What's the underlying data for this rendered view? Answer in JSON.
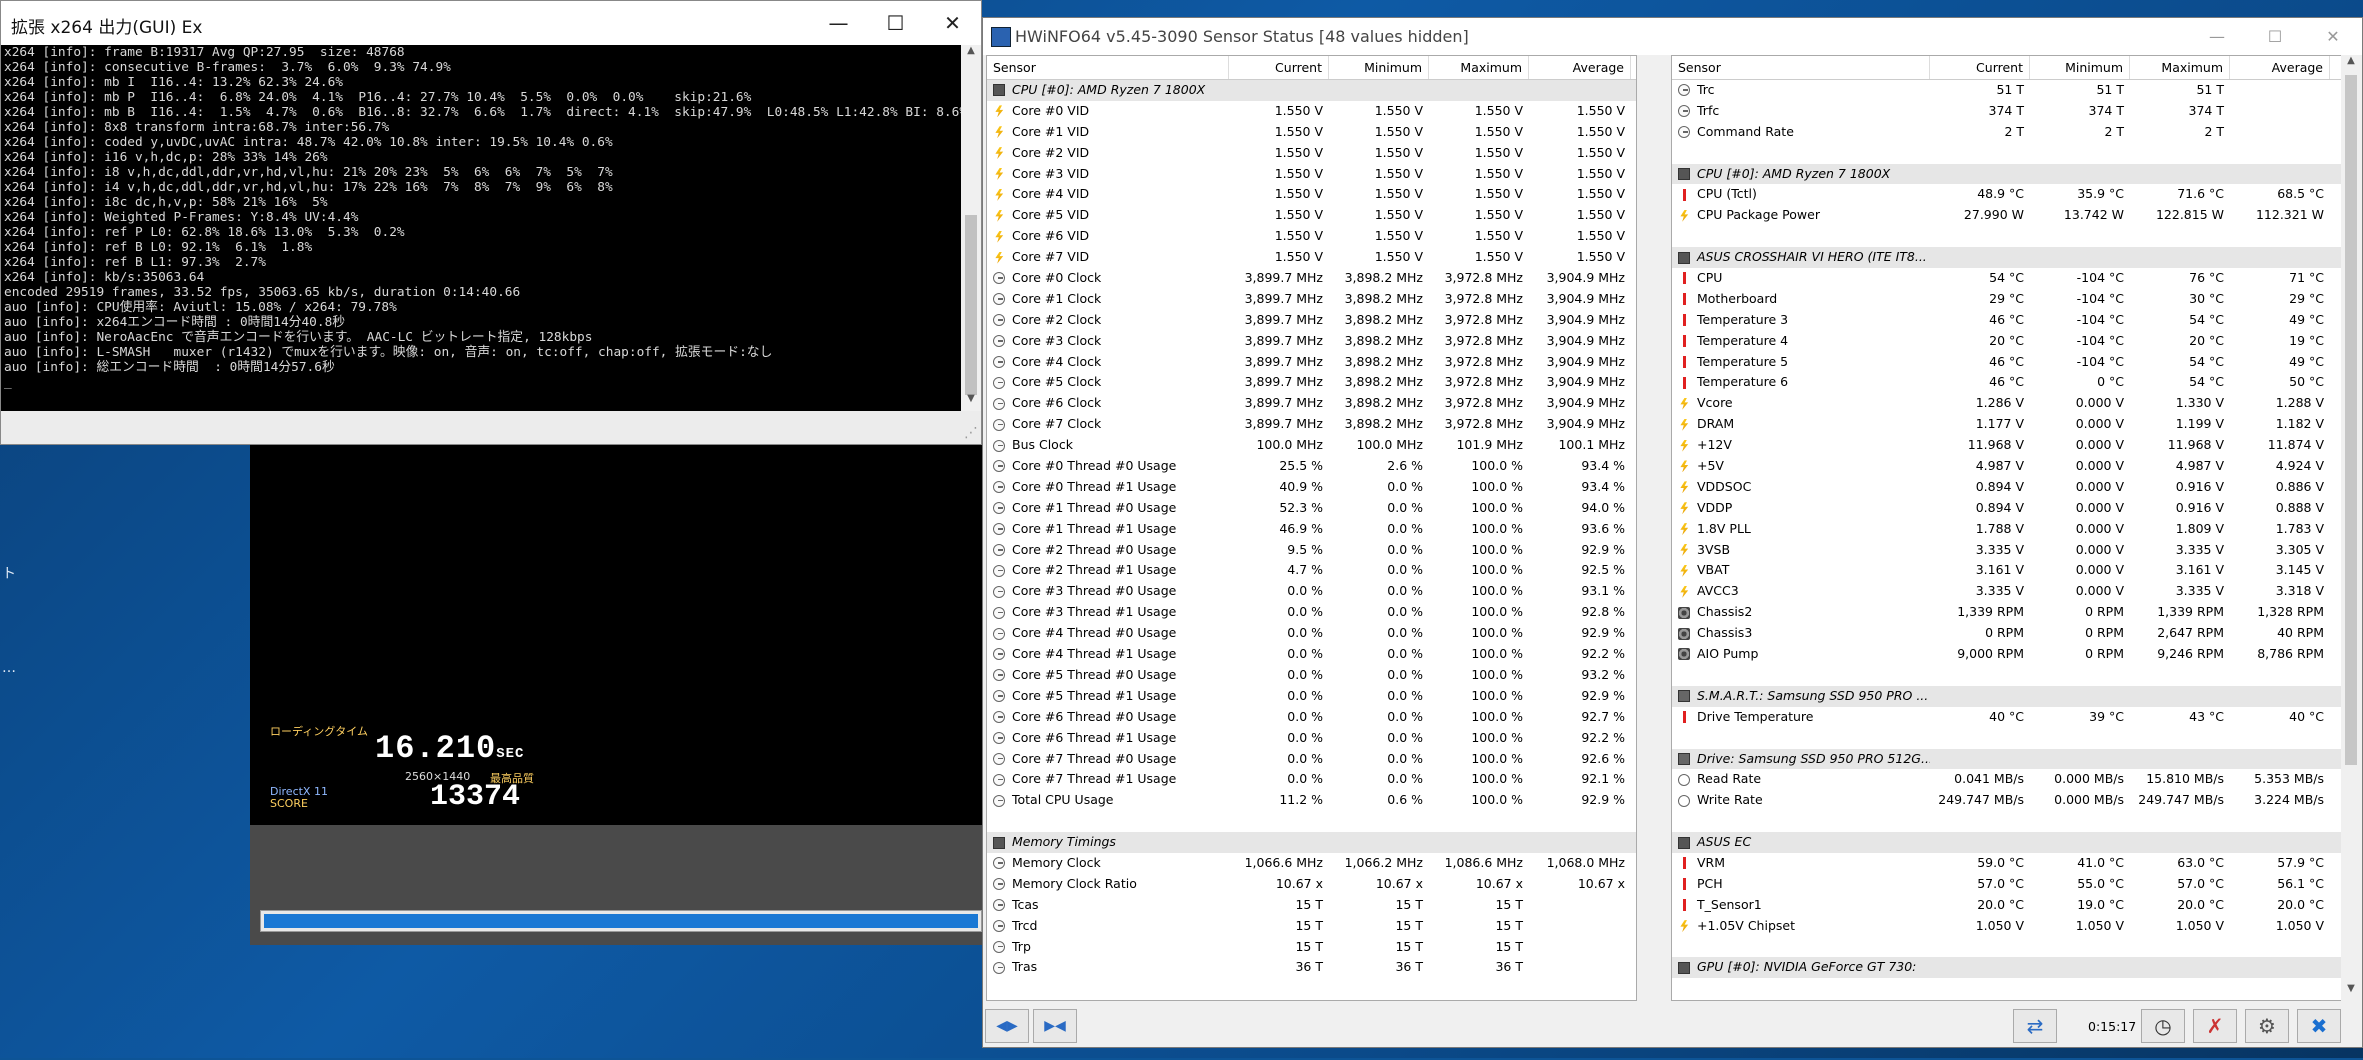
{
  "x264": {
    "title": "拡張 x264 出力(GUI) Ex",
    "lines": [
      "x264 [info]: frame B:19317 Avg QP:27.95  size: 48768",
      "x264 [info]: consecutive B-frames:  3.7%  6.0%  9.3% 74.9%",
      "x264 [info]: mb I  I16..4: 13.2% 62.3% 24.6%",
      "x264 [info]: mb P  I16..4:  6.8% 24.0%  4.1%  P16..4: 27.7% 10.4%  5.5%  0.0%  0.0%    skip:21.6%",
      "x264 [info]: mb B  I16..4:  1.5%  4.7%  0.6%  B16..8: 32.7%  6.6%  1.7%  direct: 4.1%  skip:47.9%  L0:48.5% L1:42.8% BI: 8.6%",
      "x264 [info]: 8x8 transform intra:68.7% inter:56.7%",
      "x264 [info]: coded y,uvDC,uvAC intra: 48.7% 42.0% 10.8% inter: 19.5% 10.4% 0.6%",
      "x264 [info]: i16 v,h,dc,p: 28% 33% 14% 26%",
      "x264 [info]: i8 v,h,dc,ddl,ddr,vr,hd,vl,hu: 21% 20% 23%  5%  6%  6%  7%  5%  7%",
      "x264 [info]: i4 v,h,dc,ddl,ddr,vr,hd,vl,hu: 17% 22% 16%  7%  8%  7%  9%  6%  8%",
      "x264 [info]: i8c dc,h,v,p: 58% 21% 16%  5%",
      "x264 [info]: Weighted P-Frames: Y:8.4% UV:4.4%",
      "x264 [info]: ref P L0: 62.8% 18.6% 13.0%  5.3%  0.2%",
      "x264 [info]: ref B L0: 92.1%  6.1%  1.8%",
      "x264 [info]: ref B L1: 97.3%  2.7%",
      "x264 [info]: kb/s:35063.64",
      "",
      "encoded 29519 frames, 33.52 fps, 35063.65 kb/s, duration 0:14:40.66",
      "auo [info]: CPU使用率: Aviutl: 15.08% / x264: 79.78%",
      "auo [info]: x264エンコード時間 : 0時間14分40.8秒",
      "auo [info]: NeroAacEnc で音声エンコードを行います。 AAC-LC ビットレート指定, 128kbps",
      "auo [info]: L-SMASH   muxer (r1432) でmuxを行います。映像: on, 音声: on, tc:off, chap:off, 拡張モード:なし",
      "auo [info]: 総エンコード時間  : 0時間14分57.6秒",
      "_"
    ]
  },
  "desktop": {
    "side_text_1": "ト",
    "side_text_2": "…"
  },
  "game": {
    "loading_label": "ローディングタイム",
    "time": "16.210",
    "time_unit": "SEC",
    "resolution": "2560×1440",
    "quality": "最高品質",
    "directx": "DirectX 11",
    "score_label": "SCORE",
    "score": "13374",
    "progress": 1.0
  },
  "hwinfo": {
    "title": "HWiNFO64 v5.45-3090 Sensor Status [48 values hidden]",
    "columns": [
      "Sensor",
      "Current",
      "Minimum",
      "Maximum",
      "Average"
    ],
    "left_rows": [
      {
        "t": "g",
        "name": "CPU [#0]: AMD Ryzen 7 1800X",
        "icon": "chip"
      },
      {
        "name": "Core #0 VID",
        "icon": "volt",
        "cur": "1.550 V",
        "min": "1.550 V",
        "max": "1.550 V",
        "avg": "1.550 V"
      },
      {
        "name": "Core #1 VID",
        "icon": "volt",
        "cur": "1.550 V",
        "min": "1.550 V",
        "max": "1.550 V",
        "avg": "1.550 V"
      },
      {
        "name": "Core #2 VID",
        "icon": "volt",
        "cur": "1.550 V",
        "min": "1.550 V",
        "max": "1.550 V",
        "avg": "1.550 V"
      },
      {
        "name": "Core #3 VID",
        "icon": "volt",
        "cur": "1.550 V",
        "min": "1.550 V",
        "max": "1.550 V",
        "avg": "1.550 V"
      },
      {
        "name": "Core #4 VID",
        "icon": "volt",
        "cur": "1.550 V",
        "min": "1.550 V",
        "max": "1.550 V",
        "avg": "1.550 V"
      },
      {
        "name": "Core #5 VID",
        "icon": "volt",
        "cur": "1.550 V",
        "min": "1.550 V",
        "max": "1.550 V",
        "avg": "1.550 V"
      },
      {
        "name": "Core #6 VID",
        "icon": "volt",
        "cur": "1.550 V",
        "min": "1.550 V",
        "max": "1.550 V",
        "avg": "1.550 V"
      },
      {
        "name": "Core #7 VID",
        "icon": "volt",
        "cur": "1.550 V",
        "min": "1.550 V",
        "max": "1.550 V",
        "avg": "1.550 V"
      },
      {
        "name": "Core #0 Clock",
        "icon": "clock",
        "cur": "3,899.7 MHz",
        "min": "3,898.2 MHz",
        "max": "3,972.8 MHz",
        "avg": "3,904.9 MHz"
      },
      {
        "name": "Core #1 Clock",
        "icon": "clock",
        "cur": "3,899.7 MHz",
        "min": "3,898.2 MHz",
        "max": "3,972.8 MHz",
        "avg": "3,904.9 MHz"
      },
      {
        "name": "Core #2 Clock",
        "icon": "clock",
        "cur": "3,899.7 MHz",
        "min": "3,898.2 MHz",
        "max": "3,972.8 MHz",
        "avg": "3,904.9 MHz"
      },
      {
        "name": "Core #3 Clock",
        "icon": "clock",
        "cur": "3,899.7 MHz",
        "min": "3,898.2 MHz",
        "max": "3,972.8 MHz",
        "avg": "3,904.9 MHz"
      },
      {
        "name": "Core #4 Clock",
        "icon": "clock",
        "cur": "3,899.7 MHz",
        "min": "3,898.2 MHz",
        "max": "3,972.8 MHz",
        "avg": "3,904.9 MHz"
      },
      {
        "name": "Core #5 Clock",
        "icon": "clock",
        "cur": "3,899.7 MHz",
        "min": "3,898.2 MHz",
        "max": "3,972.8 MHz",
        "avg": "3,904.9 MHz"
      },
      {
        "name": "Core #6 Clock",
        "icon": "clock",
        "cur": "3,899.7 MHz",
        "min": "3,898.2 MHz",
        "max": "3,972.8 MHz",
        "avg": "3,904.9 MHz"
      },
      {
        "name": "Core #7 Clock",
        "icon": "clock",
        "cur": "3,899.7 MHz",
        "min": "3,898.2 MHz",
        "max": "3,972.8 MHz",
        "avg": "3,904.9 MHz"
      },
      {
        "name": "Bus Clock",
        "icon": "clock",
        "cur": "100.0 MHz",
        "min": "100.0 MHz",
        "max": "101.9 MHz",
        "avg": "100.1 MHz"
      },
      {
        "name": "Core #0 Thread #0 Usage",
        "icon": "clock",
        "cur": "25.5 %",
        "min": "2.6 %",
        "max": "100.0 %",
        "avg": "93.4 %"
      },
      {
        "name": "Core #0 Thread #1 Usage",
        "icon": "clock",
        "cur": "40.9 %",
        "min": "0.0 %",
        "max": "100.0 %",
        "avg": "93.4 %"
      },
      {
        "name": "Core #1 Thread #0 Usage",
        "icon": "clock",
        "cur": "52.3 %",
        "min": "0.0 %",
        "max": "100.0 %",
        "avg": "94.0 %"
      },
      {
        "name": "Core #1 Thread #1 Usage",
        "icon": "clock",
        "cur": "46.9 %",
        "min": "0.0 %",
        "max": "100.0 %",
        "avg": "93.6 %"
      },
      {
        "name": "Core #2 Thread #0 Usage",
        "icon": "clock",
        "cur": "9.5 %",
        "min": "0.0 %",
        "max": "100.0 %",
        "avg": "92.9 %"
      },
      {
        "name": "Core #2 Thread #1 Usage",
        "icon": "clock",
        "cur": "4.7 %",
        "min": "0.0 %",
        "max": "100.0 %",
        "avg": "92.5 %"
      },
      {
        "name": "Core #3 Thread #0 Usage",
        "icon": "clock",
        "cur": "0.0 %",
        "min": "0.0 %",
        "max": "100.0 %",
        "avg": "93.1 %"
      },
      {
        "name": "Core #3 Thread #1 Usage",
        "icon": "clock",
        "cur": "0.0 %",
        "min": "0.0 %",
        "max": "100.0 %",
        "avg": "92.8 %"
      },
      {
        "name": "Core #4 Thread #0 Usage",
        "icon": "clock",
        "cur": "0.0 %",
        "min": "0.0 %",
        "max": "100.0 %",
        "avg": "92.9 %"
      },
      {
        "name": "Core #4 Thread #1 Usage",
        "icon": "clock",
        "cur": "0.0 %",
        "min": "0.0 %",
        "max": "100.0 %",
        "avg": "92.2 %"
      },
      {
        "name": "Core #5 Thread #0 Usage",
        "icon": "clock",
        "cur": "0.0 %",
        "min": "0.0 %",
        "max": "100.0 %",
        "avg": "93.2 %"
      },
      {
        "name": "Core #5 Thread #1 Usage",
        "icon": "clock",
        "cur": "0.0 %",
        "min": "0.0 %",
        "max": "100.0 %",
        "avg": "92.9 %"
      },
      {
        "name": "Core #6 Thread #0 Usage",
        "icon": "clock",
        "cur": "0.0 %",
        "min": "0.0 %",
        "max": "100.0 %",
        "avg": "92.7 %"
      },
      {
        "name": "Core #6 Thread #1 Usage",
        "icon": "clock",
        "cur": "0.0 %",
        "min": "0.0 %",
        "max": "100.0 %",
        "avg": "92.2 %"
      },
      {
        "name": "Core #7 Thread #0 Usage",
        "icon": "clock",
        "cur": "0.0 %",
        "min": "0.0 %",
        "max": "100.0 %",
        "avg": "92.6 %"
      },
      {
        "name": "Core #7 Thread #1 Usage",
        "icon": "clock",
        "cur": "0.0 %",
        "min": "0.0 %",
        "max": "100.0 %",
        "avg": "92.1 %"
      },
      {
        "name": "Total CPU Usage",
        "icon": "clock",
        "cur": "11.2 %",
        "min": "0.6 %",
        "max": "100.0 %",
        "avg": "92.9 %"
      },
      {
        "t": "b"
      },
      {
        "t": "g",
        "name": "Memory Timings",
        "icon": "chip"
      },
      {
        "name": "Memory Clock",
        "icon": "clock",
        "cur": "1,066.6 MHz",
        "min": "1,066.2 MHz",
        "max": "1,086.6 MHz",
        "avg": "1,068.0 MHz"
      },
      {
        "name": "Memory Clock Ratio",
        "icon": "clock",
        "cur": "10.67 x",
        "min": "10.67 x",
        "max": "10.67 x",
        "avg": "10.67 x"
      },
      {
        "name": "Tcas",
        "icon": "clock",
        "cur": "15 T",
        "min": "15 T",
        "max": "15 T",
        "avg": ""
      },
      {
        "name": "Trcd",
        "icon": "clock",
        "cur": "15 T",
        "min": "15 T",
        "max": "15 T",
        "avg": ""
      },
      {
        "name": "Trp",
        "icon": "clock",
        "cur": "15 T",
        "min": "15 T",
        "max": "15 T",
        "avg": ""
      },
      {
        "name": "Tras",
        "icon": "clock",
        "cur": "36 T",
        "min": "36 T",
        "max": "36 T",
        "avg": ""
      }
    ],
    "right_rows": [
      {
        "name": "Trc",
        "icon": "clock",
        "cur": "51 T",
        "min": "51 T",
        "max": "51 T",
        "avg": ""
      },
      {
        "name": "Trfc",
        "icon": "clock",
        "cur": "374 T",
        "min": "374 T",
        "max": "374 T",
        "avg": ""
      },
      {
        "name": "Command Rate",
        "icon": "clock",
        "cur": "2 T",
        "min": "2 T",
        "max": "2 T",
        "avg": ""
      },
      {
        "t": "b"
      },
      {
        "t": "g",
        "name": "CPU [#0]: AMD Ryzen 7 1800X",
        "icon": "chip"
      },
      {
        "name": "CPU (Tctl)",
        "icon": "temp",
        "cur": "48.9 °C",
        "min": "35.9 °C",
        "max": "71.6 °C",
        "avg": "68.5 °C"
      },
      {
        "name": "CPU Package Power",
        "icon": "power",
        "cur": "27.990 W",
        "min": "13.742 W",
        "max": "122.815 W",
        "avg": "112.321 W"
      },
      {
        "t": "b"
      },
      {
        "t": "g",
        "name": "ASUS CROSSHAIR VI HERO (ITE IT8...",
        "icon": "chip"
      },
      {
        "name": "CPU",
        "icon": "temp",
        "cur": "54 °C",
        "min": "-104 °C",
        "max": "76 °C",
        "avg": "71 °C"
      },
      {
        "name": "Motherboard",
        "icon": "temp",
        "cur": "29 °C",
        "min": "-104 °C",
        "max": "30 °C",
        "avg": "29 °C"
      },
      {
        "name": "Temperature 3",
        "icon": "temp",
        "cur": "46 °C",
        "min": "-104 °C",
        "max": "54 °C",
        "avg": "49 °C"
      },
      {
        "name": "Temperature 4",
        "icon": "temp",
        "cur": "20 °C",
        "min": "-104 °C",
        "max": "20 °C",
        "avg": "19 °C"
      },
      {
        "name": "Temperature 5",
        "icon": "temp",
        "cur": "46 °C",
        "min": "-104 °C",
        "max": "54 °C",
        "avg": "49 °C"
      },
      {
        "name": "Temperature 6",
        "icon": "temp",
        "cur": "46 °C",
        "min": "0 °C",
        "max": "54 °C",
        "avg": "50 °C"
      },
      {
        "name": "Vcore",
        "icon": "volt",
        "cur": "1.286 V",
        "min": "0.000 V",
        "max": "1.330 V",
        "avg": "1.288 V"
      },
      {
        "name": "DRAM",
        "icon": "volt",
        "cur": "1.177 V",
        "min": "0.000 V",
        "max": "1.199 V",
        "avg": "1.182 V"
      },
      {
        "name": "+12V",
        "icon": "volt",
        "cur": "11.968 V",
        "min": "0.000 V",
        "max": "11.968 V",
        "avg": "11.874 V"
      },
      {
        "name": "+5V",
        "icon": "volt",
        "cur": "4.987 V",
        "min": "0.000 V",
        "max": "4.987 V",
        "avg": "4.924 V"
      },
      {
        "name": "VDDSOC",
        "icon": "volt",
        "cur": "0.894 V",
        "min": "0.000 V",
        "max": "0.916 V",
        "avg": "0.886 V"
      },
      {
        "name": "VDDP",
        "icon": "volt",
        "cur": "0.894 V",
        "min": "0.000 V",
        "max": "0.916 V",
        "avg": "0.888 V"
      },
      {
        "name": "1.8V PLL",
        "icon": "volt",
        "cur": "1.788 V",
        "min": "0.000 V",
        "max": "1.809 V",
        "avg": "1.783 V"
      },
      {
        "name": "3VSB",
        "icon": "volt",
        "cur": "3.335 V",
        "min": "0.000 V",
        "max": "3.335 V",
        "avg": "3.305 V"
      },
      {
        "name": "VBAT",
        "icon": "volt",
        "cur": "3.161 V",
        "min": "0.000 V",
        "max": "3.161 V",
        "avg": "3.145 V"
      },
      {
        "name": "AVCC3",
        "icon": "volt",
        "cur": "3.335 V",
        "min": "0.000 V",
        "max": "3.335 V",
        "avg": "3.318 V"
      },
      {
        "name": "Chassis2",
        "icon": "fan",
        "cur": "1,339 RPM",
        "min": "0 RPM",
        "max": "1,339 RPM",
        "avg": "1,328 RPM"
      },
      {
        "name": "Chassis3",
        "icon": "fan",
        "cur": "0 RPM",
        "min": "0 RPM",
        "max": "2,647 RPM",
        "avg": "40 RPM"
      },
      {
        "name": "AIO Pump",
        "icon": "fan",
        "cur": "9,000 RPM",
        "min": "0 RPM",
        "max": "9,246 RPM",
        "avg": "8,786 RPM"
      },
      {
        "t": "b"
      },
      {
        "t": "g",
        "name": "S.M.A.R.T.: Samsung SSD 950 PRO ...",
        "icon": "disk"
      },
      {
        "name": "Drive Temperature",
        "icon": "temp",
        "cur": "40 °C",
        "min": "39 °C",
        "max": "43 °C",
        "avg": "40 °C"
      },
      {
        "t": "b"
      },
      {
        "t": "g",
        "name": "Drive: Samsung SSD 950 PRO 512G...",
        "icon": "disk"
      },
      {
        "name": "Read Rate",
        "icon": "misc",
        "cur": "0.041 MB/s",
        "min": "0.000 MB/s",
        "max": "15.810 MB/s",
        "avg": "5.353 MB/s"
      },
      {
        "name": "Write Rate",
        "icon": "misc",
        "cur": "249.747 MB/s",
        "min": "0.000 MB/s",
        "max": "249.747 MB/s",
        "avg": "3.224 MB/s"
      },
      {
        "t": "b"
      },
      {
        "t": "g",
        "name": "ASUS EC",
        "icon": "chip"
      },
      {
        "name": "VRM",
        "icon": "temp",
        "cur": "59.0 °C",
        "min": "41.0 °C",
        "max": "63.0 °C",
        "avg": "57.9 °C"
      },
      {
        "name": "PCH",
        "icon": "temp",
        "cur": "57.0 °C",
        "min": "55.0 °C",
        "max": "57.0 °C",
        "avg": "56.1 °C"
      },
      {
        "name": "T_Sensor1",
        "icon": "temp",
        "cur": "20.0 °C",
        "min": "19.0 °C",
        "max": "20.0 °C",
        "avg": "20.0 °C"
      },
      {
        "name": "+1.05V Chipset",
        "icon": "volt",
        "cur": "1.050 V",
        "min": "1.050 V",
        "max": "1.050 V",
        "avg": "1.050 V"
      },
      {
        "t": "b"
      },
      {
        "t": "g",
        "name": "GPU [#0]: NVIDIA GeForce GT 730:",
        "icon": "chip"
      }
    ],
    "timer": "0:15:17",
    "buttons": {
      "back": "◀▶",
      "forward": "▶◀"
    }
  }
}
